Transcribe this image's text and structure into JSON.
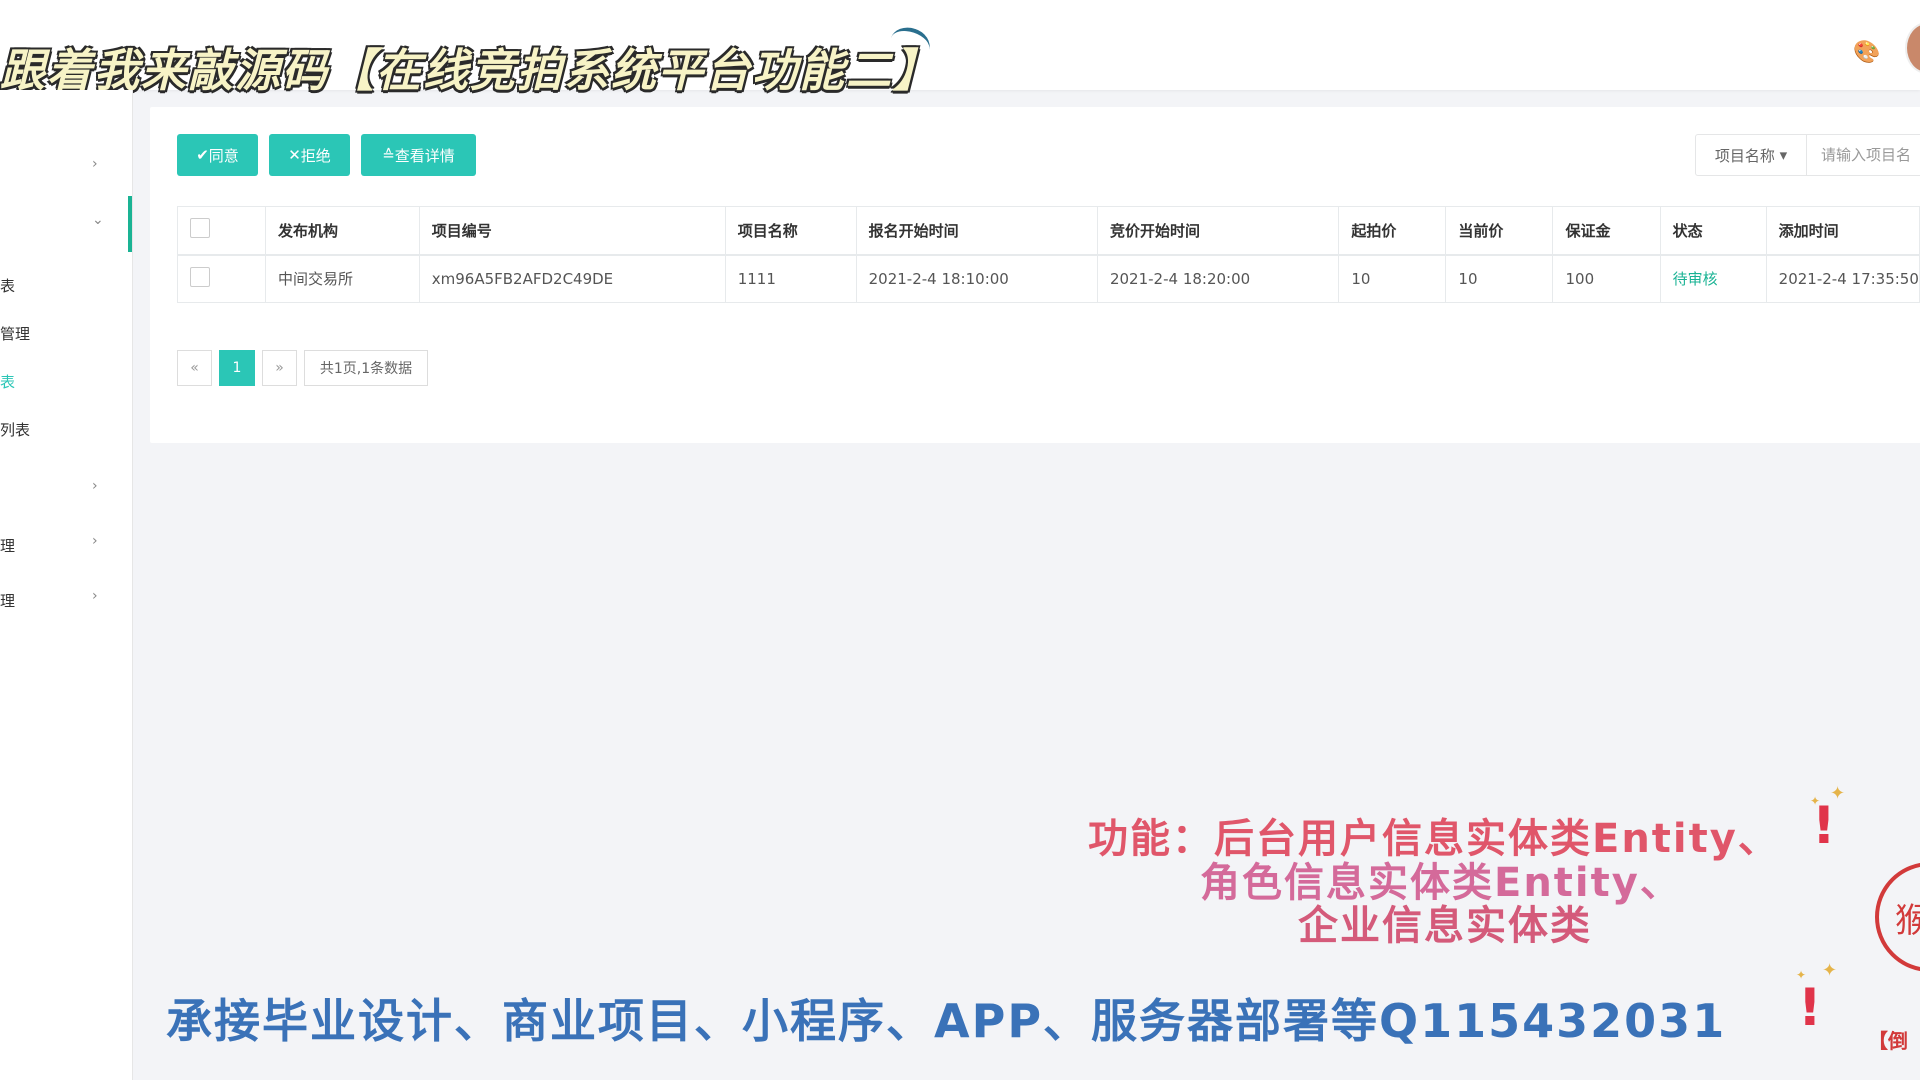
{
  "banner": {
    "title": "跟着我来敲源码【在线竞拍系统平台功能二】"
  },
  "header": {
    "palette_icon": "palette-icon"
  },
  "sidebar": {
    "items": [
      {
        "label": "",
        "arrow": "›"
      },
      {
        "label": "",
        "arrow": "⌄"
      },
      {
        "label": "表",
        "arrow": ""
      },
      {
        "label": "管理",
        "arrow": ""
      },
      {
        "label": "表",
        "arrow": ""
      },
      {
        "label": "列表",
        "arrow": ""
      },
      {
        "label": "",
        "arrow": "›"
      },
      {
        "label": "理",
        "arrow": "›"
      },
      {
        "label": "理",
        "arrow": "›"
      }
    ]
  },
  "toolbar": {
    "approve_label": "同意",
    "reject_label": "拒绝",
    "details_label": "查看详情"
  },
  "search": {
    "field_label": "项目名称",
    "placeholder": "请输入项目名"
  },
  "table": {
    "headers": [
      "发布机构",
      "项目编号",
      "项目名称",
      "报名开始时间",
      "竞价开始时间",
      "起拍价",
      "当前价",
      "保证金",
      "状态",
      "添加时间"
    ],
    "rows": [
      {
        "org": "中间交易所",
        "code": "xm96A5FB2AFD2C49DE",
        "name": "1111",
        "signup_start": "2021-2-4 18:10:00",
        "bid_start": "2021-2-4 18:20:00",
        "start_price": "10",
        "current_price": "10",
        "deposit": "100",
        "status": "待审核",
        "added": "2021-2-4 17:35:50"
      }
    ]
  },
  "pagination": {
    "prev": "«",
    "current": "1",
    "next": "»",
    "summary": "共1页,1条数据"
  },
  "overlay": {
    "line1": "功能：后台用户信息实体类Entity、",
    "line2": "角色信息实体类Entity、",
    "line3": "企业信息实体类",
    "ad": "承接毕业设计、商业项目、小程序、APP、服务器部署等Q115432031",
    "exclaim": "!",
    "stamp_text": "猴",
    "stamp_caption": "【倒 "
  },
  "colors": {
    "accent": "#2bc6b6",
    "status_pending": "#1ab394"
  }
}
